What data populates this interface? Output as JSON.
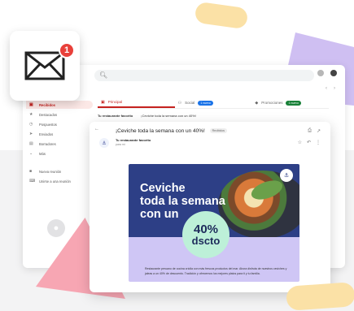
{
  "mail_icon": {
    "icon": "envelope-icon",
    "badge_count": "1"
  },
  "search": {
    "icon": "search-icon"
  },
  "sidebar": {
    "items": [
      {
        "label": "Recibidos",
        "icon": "inbox-icon",
        "active": true
      },
      {
        "label": "Destacados",
        "icon": "star-icon"
      },
      {
        "label": "Pospuestos",
        "icon": "clock-icon"
      },
      {
        "label": "Enviados",
        "icon": "send-icon"
      },
      {
        "label": "Borradores",
        "icon": "draft-icon"
      },
      {
        "label": "Más",
        "icon": "chevron-down-icon"
      }
    ],
    "secondary": [
      {
        "label": "Nueva reunión",
        "icon": "video-icon"
      },
      {
        "label": "Unirse a una reunión",
        "icon": "keyboard-icon"
      }
    ]
  },
  "tabs": [
    {
      "label": "Principal",
      "icon": "inbox-icon",
      "active": true
    },
    {
      "label": "Social",
      "icon": "people-icon",
      "badge": "1 nuevo",
      "badge_color": "#1a73e8"
    },
    {
      "label": "Promociones",
      "icon": "tag-icon",
      "badge": "1 nuevo",
      "badge_color": "#188038"
    }
  ],
  "inbox_row": {
    "sender": "Tu restaurante favorito",
    "subject": "¡Ceviche toda la semana con un 40%!"
  },
  "email": {
    "subject": "¡Ceviche toda la semana con un 40%!",
    "label": "Recibidos",
    "sender": "Tu restaurante favorito",
    "to": "para mí"
  },
  "promo": {
    "headline_1": "Ceviche",
    "headline_2": "toda la semana",
    "headline_3": "con un",
    "discount_pct": "40%",
    "discount_word": "dscto",
    "body": "Restaurante peruano de cocina criolla con más frescos productos del mar. Ahora disfruta de nuestros ceviches y jaleas a un 40% de descuento. Tradición y ofrecemos los mejores platos para ti y tu familia."
  },
  "colors": {
    "accent_red": "#c5221f",
    "promo_navy": "#2d3f86",
    "promo_lavender": "#cfc6f5",
    "promo_mint": "#bdf0d8",
    "badge_red": "#e8403a"
  }
}
